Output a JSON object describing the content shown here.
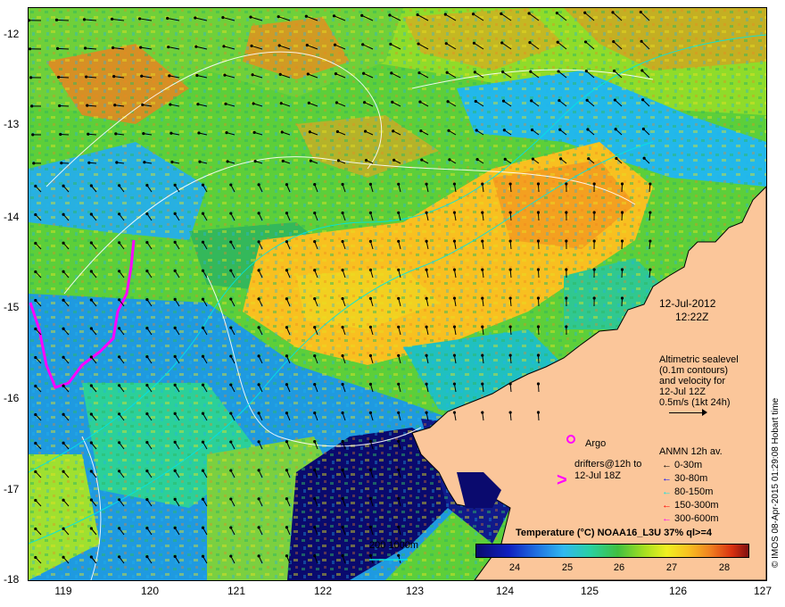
{
  "axes": {
    "y_ticks": [
      "-12",
      "-13",
      "-14",
      "-15",
      "-16",
      "-17",
      "-18"
    ],
    "x_ticks": [
      "119",
      "120",
      "121",
      "122",
      "123",
      "124",
      "125",
      "126",
      "127"
    ]
  },
  "info": {
    "date": "12-Jul-2012",
    "time": "12:22Z",
    "alt_line1": "Altimetric sealevel",
    "alt_line2": "(0.1m contours)",
    "alt_line3": "and velocity for",
    "alt_line4": "12-Jul 12Z",
    "alt_line5": "0.5m/s (1kt 24h)"
  },
  "argo_label": "Argo",
  "drifters_line1": "drifters@12h to",
  "drifters_line2": "12-Jul 18Z",
  "anmn": {
    "title": "ANMN 12h av.",
    "items": [
      {
        "label": "0-30m",
        "color": "#000000"
      },
      {
        "label": "30-80m",
        "color": "#0000ff"
      },
      {
        "label": "80-150m",
        "color": "#00e5e5"
      },
      {
        "label": "150-300m",
        "color": "#ff0000"
      },
      {
        "label": "300-600m",
        "color": "#ff00ff"
      }
    ]
  },
  "isobath_label": "200  1000m",
  "colorbar": {
    "title": "Temperature (°C) NOAA16_L3U 37% ql>=4",
    "ticks": [
      "24",
      "25",
      "26",
      "27",
      "28"
    ]
  },
  "credit": "© IMOS 08-Apr-2015 01:29:08 Hobart time",
  "colors": {
    "land": "#fbc69a",
    "cold": "#0a0a6e",
    "cyan": "#00e5e5",
    "drifter": "#ff00ff"
  }
}
